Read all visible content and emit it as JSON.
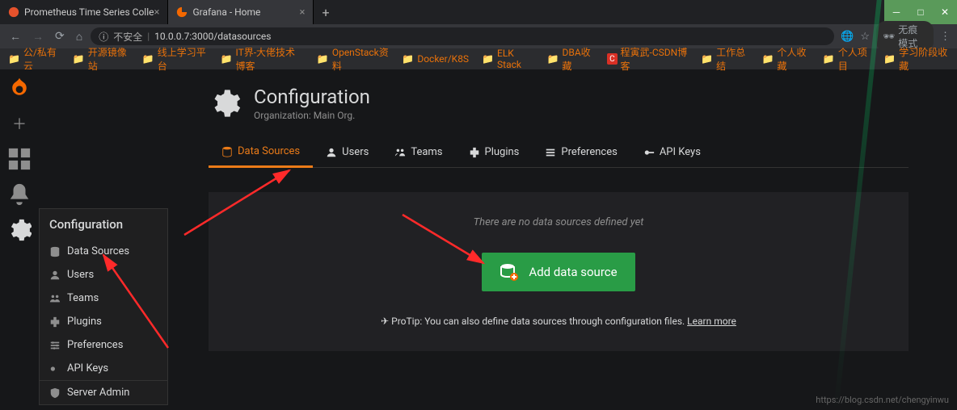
{
  "browser": {
    "tabs": [
      {
        "title": "Prometheus Time Series Colle"
      },
      {
        "title": "Grafana - Home"
      }
    ],
    "url_insecure_label": "不安全",
    "url": "10.0.0.7:3000/datasources",
    "incognito_label": "无痕模式",
    "bookmarks": [
      {
        "label": "公/私有云"
      },
      {
        "label": "开源镜像站"
      },
      {
        "label": "线上学习平台"
      },
      {
        "label": "IT界-大佬技术博客"
      },
      {
        "label": "OpenStack资料"
      },
      {
        "label": "Docker/K8S"
      },
      {
        "label": "ELK Stack"
      },
      {
        "label": "DBA收藏"
      },
      {
        "label": "程寅武-CSDN博客",
        "red": true
      },
      {
        "label": "工作总结"
      },
      {
        "label": "个人收藏"
      },
      {
        "label": "个人项目"
      },
      {
        "label": "学习阶段收藏"
      }
    ]
  },
  "sidenav": {
    "items": [
      "create",
      "dashboards",
      "alerts",
      "configuration"
    ]
  },
  "flyout": {
    "title": "Configuration",
    "items": [
      "Data Sources",
      "Users",
      "Teams",
      "Plugins",
      "Preferences",
      "API Keys"
    ],
    "admin": "Server Admin"
  },
  "page": {
    "title": "Configuration",
    "subtitle": "Organization: Main Org.",
    "tabs": [
      "Data Sources",
      "Users",
      "Teams",
      "Plugins",
      "Preferences",
      "API Keys"
    ],
    "empty_text": "There are no data sources defined yet",
    "add_button": "Add data source",
    "protip_prefix": "ProTip: You can also define data sources through configuration files. ",
    "protip_link": "Learn more"
  },
  "watermark": "https://blog.csdn.net/chengyinwu"
}
